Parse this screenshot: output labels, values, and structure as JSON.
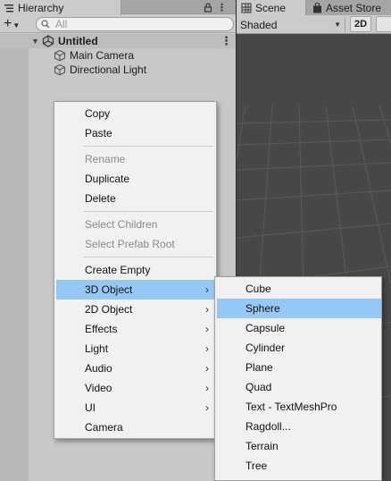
{
  "hierarchy": {
    "tab_label": "Hierarchy",
    "search_placeholder": "All",
    "scene_name": "Untitled",
    "objects": [
      "Main Camera",
      "Directional Light"
    ]
  },
  "scene_panel": {
    "tabs": [
      "Scene",
      "Asset Store"
    ],
    "shading_mode": "Shaded",
    "mode_2d_label": "2D"
  },
  "context_menu": {
    "items": [
      {
        "label": "Copy",
        "enabled": true
      },
      {
        "label": "Paste",
        "enabled": true
      },
      {
        "label": "Rename",
        "enabled": false
      },
      {
        "label": "Duplicate",
        "enabled": true
      },
      {
        "label": "Delete",
        "enabled": true
      },
      {
        "label": "Select Children",
        "enabled": false
      },
      {
        "label": "Select Prefab Root",
        "enabled": false
      },
      {
        "label": "Create Empty",
        "enabled": true
      },
      {
        "label": "3D Object",
        "enabled": true,
        "submenu": true,
        "highlighted": true
      },
      {
        "label": "2D Object",
        "enabled": true,
        "submenu": true
      },
      {
        "label": "Effects",
        "enabled": true,
        "submenu": true
      },
      {
        "label": "Light",
        "enabled": true,
        "submenu": true
      },
      {
        "label": "Audio",
        "enabled": true,
        "submenu": true
      },
      {
        "label": "Video",
        "enabled": true,
        "submenu": true
      },
      {
        "label": "UI",
        "enabled": true,
        "submenu": true
      },
      {
        "label": "Camera",
        "enabled": true
      }
    ]
  },
  "submenu_3d_object": {
    "items": [
      "Cube",
      "Sphere",
      "Capsule",
      "Cylinder",
      "Plane",
      "Quad",
      "Text - TextMeshPro",
      "Ragdoll...",
      "Terrain",
      "Tree"
    ],
    "highlighted": "Sphere"
  },
  "icons": {
    "add": "plus-icon",
    "lock": "lock-icon",
    "kebab": "kebab-menu-icon",
    "search": "search-icon",
    "scene": "unity-logo-icon",
    "gameobject": "cube-icon",
    "grid": "scene-grid-icon",
    "asset_store": "shopping-bag-icon",
    "submenu_arrow": "chevron-right-icon"
  },
  "colors": {
    "menu_highlight": "#96c8f5",
    "panel_bg": "#c8c8c8",
    "scene_bg": "#474747",
    "disabled_text": "#8a8a8a"
  }
}
